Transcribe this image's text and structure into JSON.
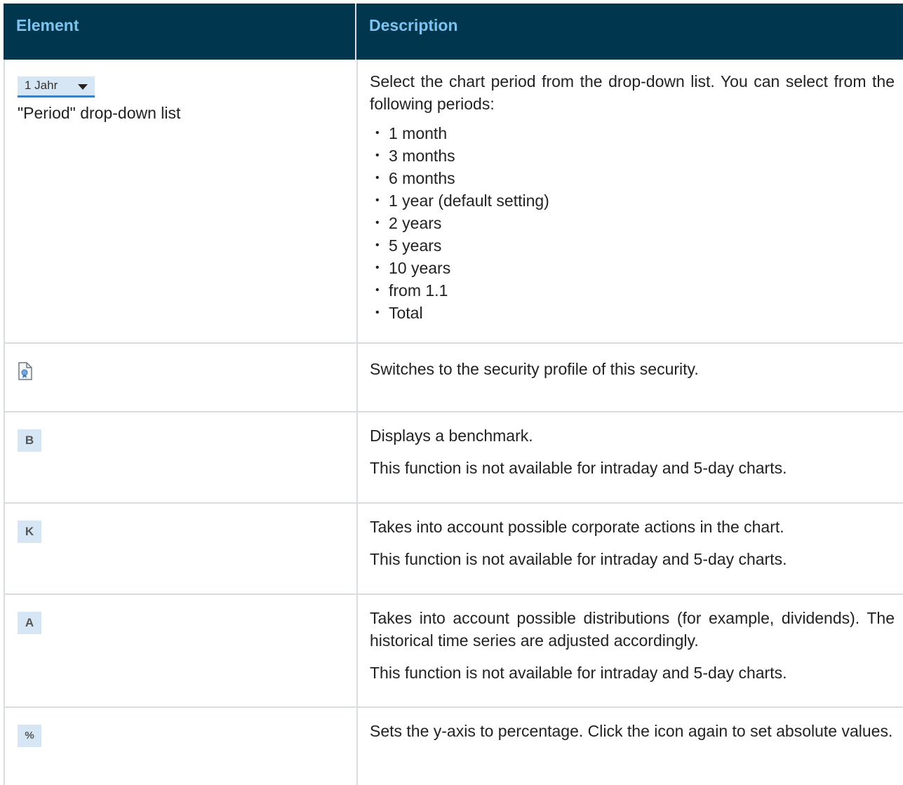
{
  "header": {
    "col1": "Element",
    "col2": "Description"
  },
  "rows": [
    {
      "element_dropdown_value": "1 Jahr",
      "element_label": "\"Period\" drop-down list",
      "description_intro": "Select the chart period from the drop-down list. You can select from the following periods:",
      "periods": [
        "1 month",
        "3 months",
        "6 months",
        "1 year (default setting)",
        "2 years",
        "5 years",
        "10 years",
        "from 1.1",
        "Total"
      ]
    },
    {
      "icon": "security-profile-icon",
      "description": "Switches to the security profile of this security."
    },
    {
      "icon_text": "B",
      "description": "Displays a benchmark.",
      "note": "This function is not available for intraday and 5-day charts."
    },
    {
      "icon_text": "K",
      "description": "Takes into account possible corporate actions in the chart.",
      "note": "This function is not available for intraday and 5-day charts."
    },
    {
      "icon_text": "A",
      "description": "Takes into account possible distributions (for example, dividends). The historical time series are adjusted accordingly.",
      "note": "This function is not available for intraday and 5-day charts."
    },
    {
      "icon_text": "%",
      "description": "Sets the y-axis to percentage. Click the icon again to set absolute values."
    }
  ],
  "colors": {
    "header_bg": "#00374f",
    "header_text": "#7ec3f0",
    "button_bg": "#d6e6f4",
    "border": "#d8dde0"
  }
}
